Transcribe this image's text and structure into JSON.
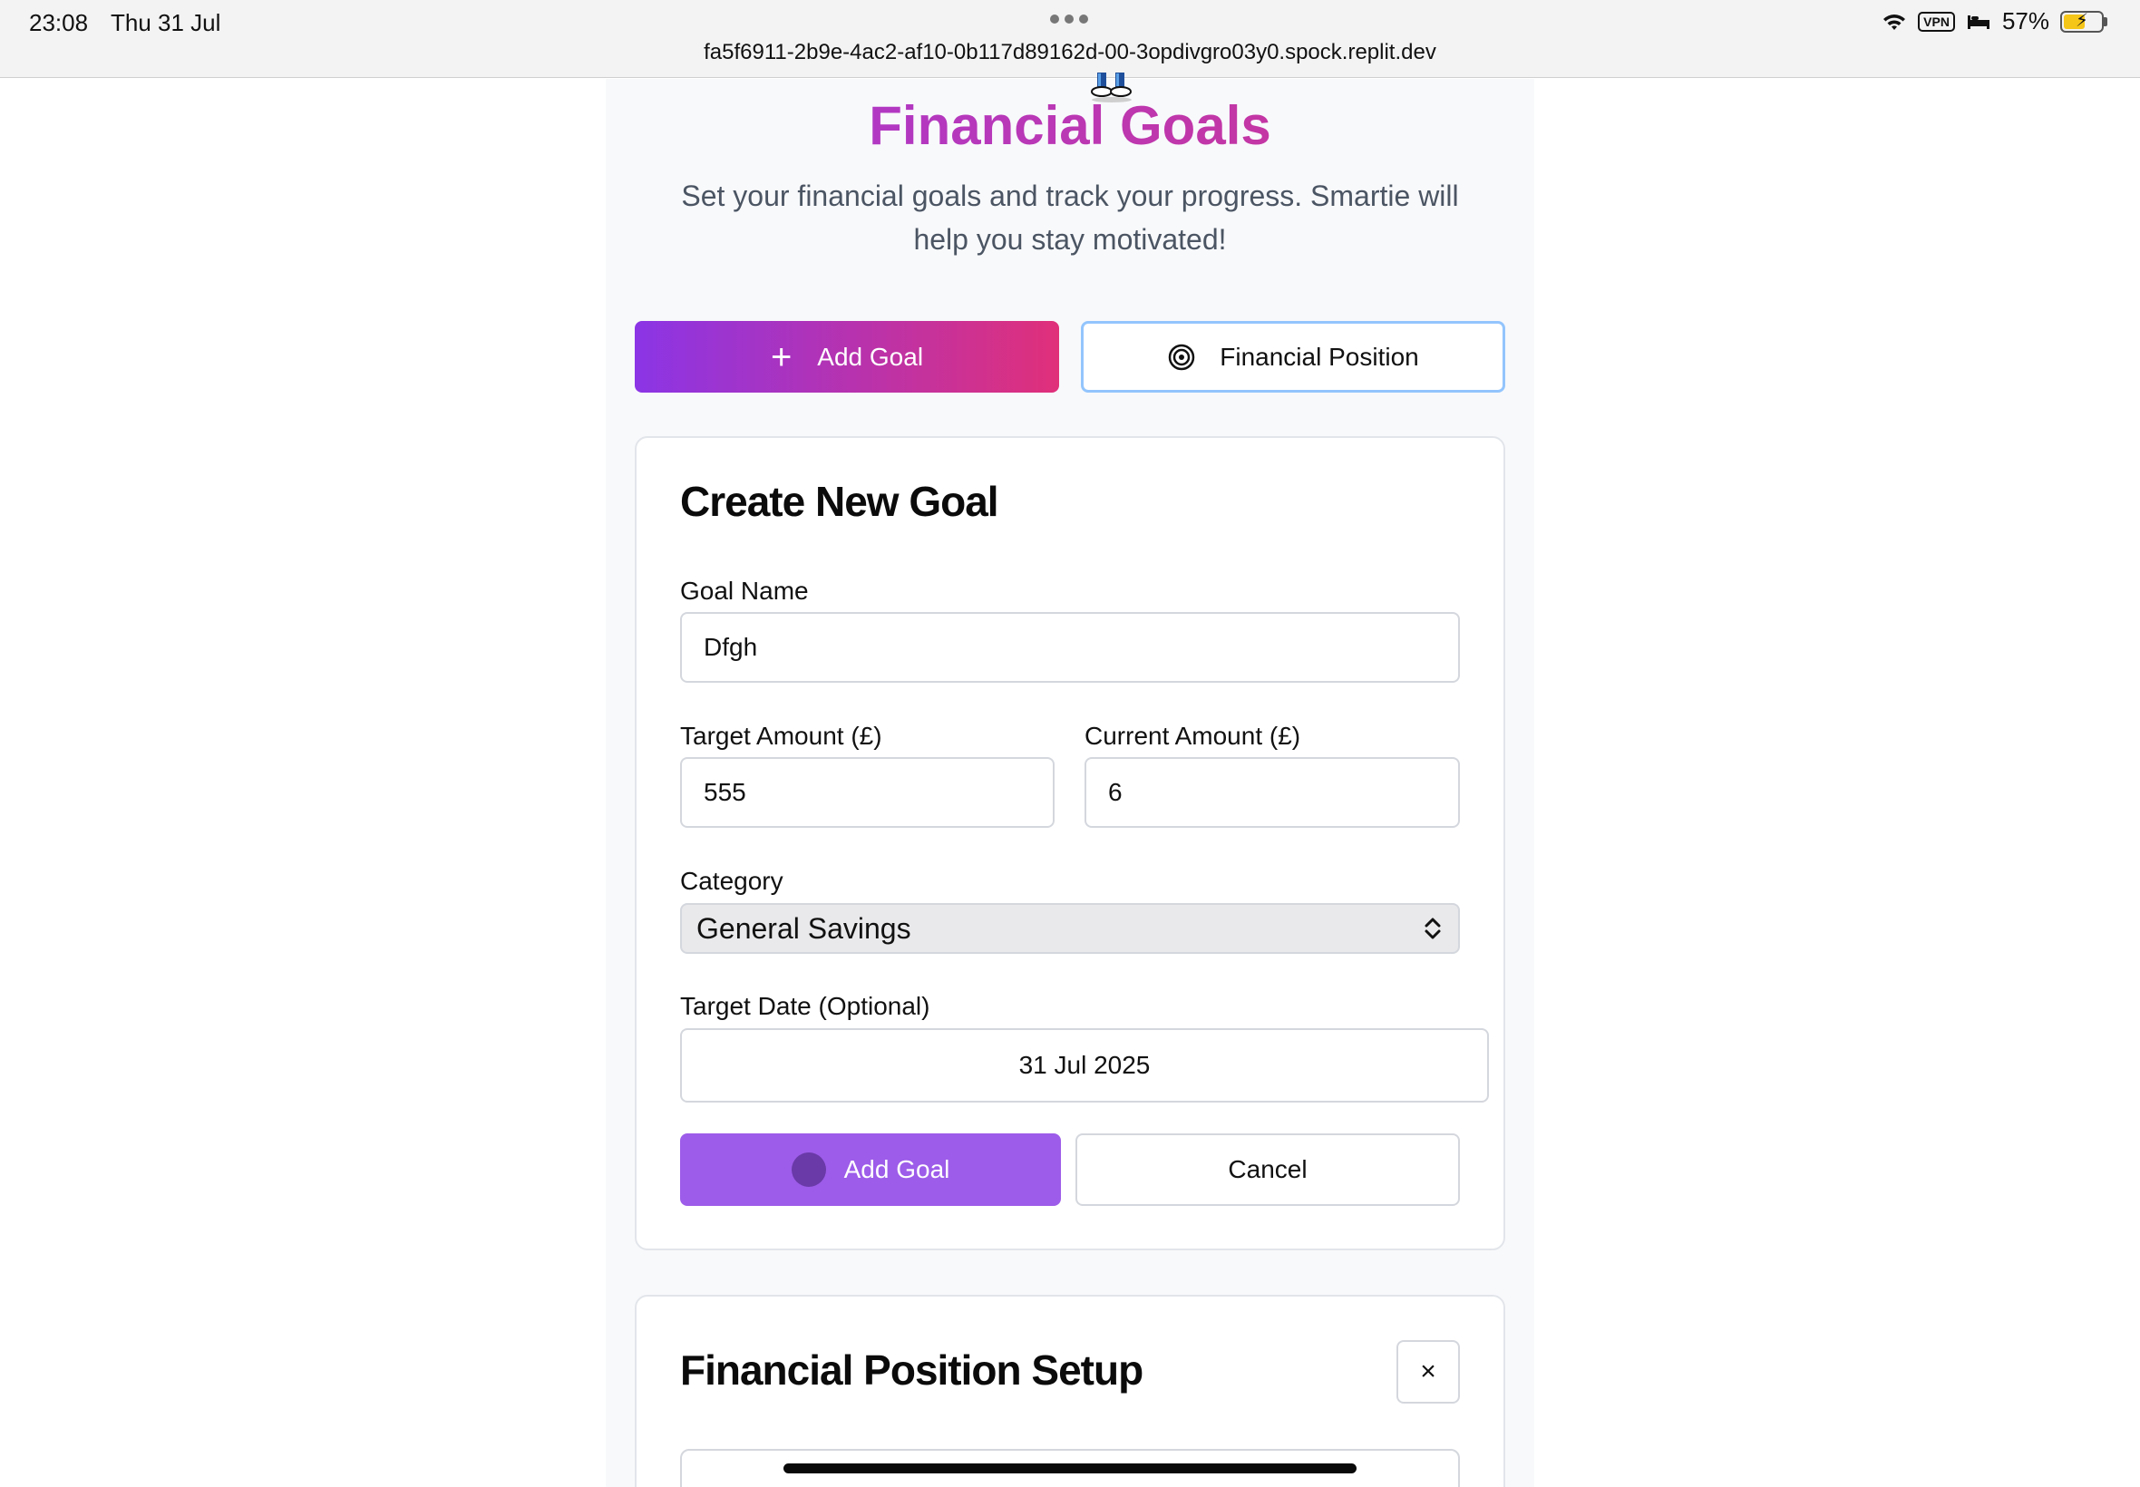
{
  "status_bar": {
    "time": "23:08",
    "date": "Thu 31 Jul",
    "url": "fa5f6911-2b9e-4ac2-af10-0b117d89162d-00-3opdivgro03y0.spock.replit.dev",
    "vpn_label": "VPN",
    "battery_percent": "57%",
    "battery_level": 0.57
  },
  "header": {
    "title": "Financial Goals",
    "subtitle": "Set your financial goals and track your progress. Smartie will help you stay motivated!"
  },
  "actions": {
    "add_goal_label": "Add Goal",
    "financial_position_label": "Financial Position"
  },
  "create_goal_form": {
    "heading": "Create New Goal",
    "goal_name_label": "Goal Name",
    "goal_name_value": "Dfgh",
    "target_amount_label": "Target Amount (£)",
    "target_amount_value": "555",
    "current_amount_label": "Current Amount (£)",
    "current_amount_value": "6",
    "category_label": "Category",
    "category_value": "General Savings",
    "target_date_label": "Target Date (Optional)",
    "target_date_value": "31 Jul 2025",
    "submit_label": "Add Goal",
    "cancel_label": "Cancel"
  },
  "financial_position_setup": {
    "heading": "Financial Position Setup",
    "close_label": "×"
  },
  "colors": {
    "brand_gradient_start": "#8b35e6",
    "brand_gradient_end": "#e0307a",
    "submit_purple": "#9d5ce9",
    "focus_blue": "#93c5fd"
  }
}
